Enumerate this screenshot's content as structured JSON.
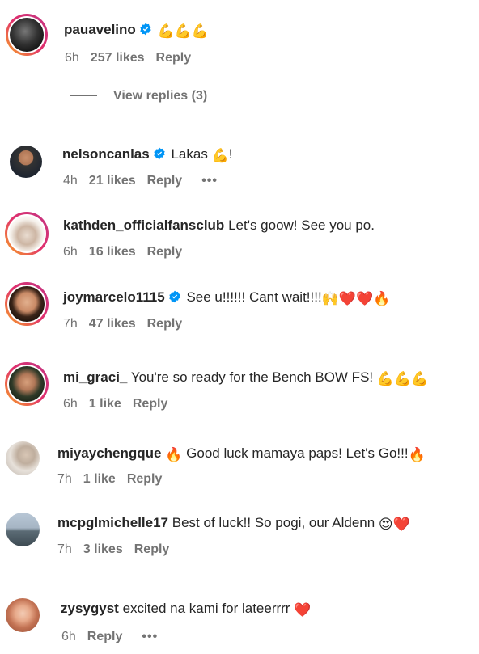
{
  "comments": [
    {
      "username": "pauavelino",
      "verified": true,
      "text": "",
      "emoji": "💪💪💪",
      "time": "6h",
      "likes": "257 likes",
      "reply": "Reply"
    },
    {
      "username": "nelsoncanlas",
      "verified": true,
      "text": "Lakas",
      "emoji": "💪",
      "suffix": "!",
      "time": "4h",
      "likes": "21 likes",
      "reply": "Reply",
      "more": "•••"
    },
    {
      "username": "kathden_officialfansclub",
      "verified": false,
      "text": "Let's goow! See you po.",
      "emoji": "",
      "time": "6h",
      "likes": "16 likes",
      "reply": "Reply"
    },
    {
      "username": "joymarcelo1115",
      "verified": true,
      "text": "See u!!!!!! Cant wait!!!!",
      "emoji": "🙌❤️❤️🔥",
      "time": "7h",
      "likes": "47 likes",
      "reply": "Reply"
    },
    {
      "username": "mi_graci_",
      "verified": false,
      "text": "You're so ready for the Bench BOW FS!",
      "emoji": "💪💪💪",
      "time": "6h",
      "likes": "1 like",
      "reply": "Reply"
    },
    {
      "username": "miyaychengque",
      "verified": false,
      "pre_emoji": "🔥",
      "text": "Good luck mamaya paps! Let's Go!!!",
      "emoji": "🔥",
      "time": "7h",
      "likes": "1 like",
      "reply": "Reply"
    },
    {
      "username": "mcpglmichelle17",
      "verified": false,
      "text": "Best of luck!! So pogi, our Aldenn",
      "emoji": "😍❤️",
      "time": "7h",
      "likes": "3 likes",
      "reply": "Reply"
    },
    {
      "username": "zysygyst",
      "verified": false,
      "text": "excited na kami for lateerrrr",
      "emoji": "❤️",
      "time": "6h",
      "likes": "",
      "reply": "Reply",
      "more": "•••"
    }
  ],
  "view_replies": "View replies (3)",
  "icons": {
    "verified": "verified-badge-icon",
    "more": "more-options-icon"
  },
  "colors": {
    "verified": "#0095f6",
    "text": "#262626",
    "meta": "#737373"
  }
}
